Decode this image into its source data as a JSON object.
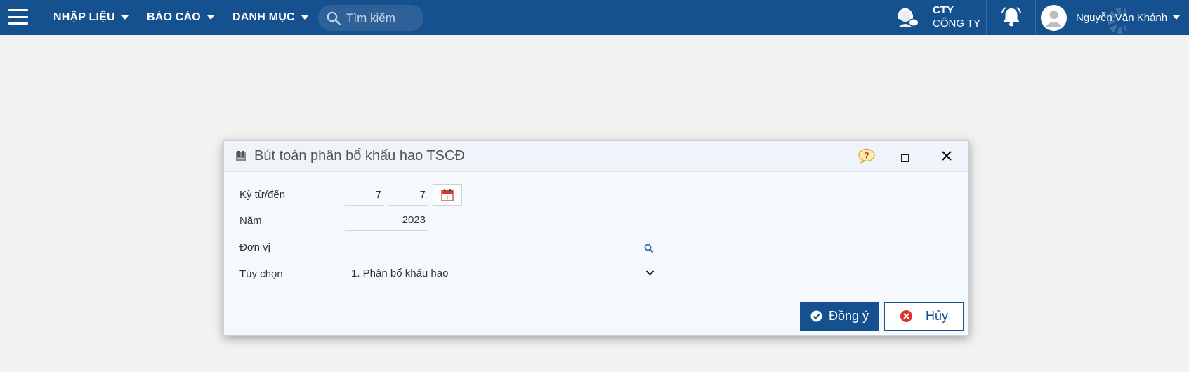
{
  "topbar": {
    "nav": [
      {
        "label": "NHẬP LIỆU"
      },
      {
        "label": "BÁO CÁO"
      },
      {
        "label": "DANH MỤC"
      }
    ],
    "search_placeholder": "Tìm kiếm",
    "company_code": "CTY",
    "company_name": "CÔNG TY",
    "user_name": "Nguyễn Văn Khánh"
  },
  "dialog": {
    "title": "Bút toán phân bổ khấu hao TSCĐ",
    "fields": {
      "period_label": "Kỳ từ/đến",
      "period_from": "7",
      "period_to": "7",
      "year_label": "Năm",
      "year_value": "2023",
      "unit_label": "Đơn vị",
      "unit_value": "",
      "option_label": "Tùy chọn",
      "option_value": "1. Phân bổ khấu hao"
    },
    "ok_label": "Đồng ý",
    "cancel_label": "Hủy"
  },
  "colors": {
    "topbar": "#15508f",
    "accent": "#15508f",
    "page_bg": "#f2f2f2"
  },
  "icons": [
    "hamburger-icon",
    "search-icon",
    "support-icon",
    "bell-icon",
    "avatar-icon",
    "gear-icon",
    "ledger-icon",
    "help-icon",
    "maximize-icon",
    "close-icon",
    "calendar-icon",
    "chevron-down-icon",
    "check-icon",
    "cancel-icon"
  ]
}
